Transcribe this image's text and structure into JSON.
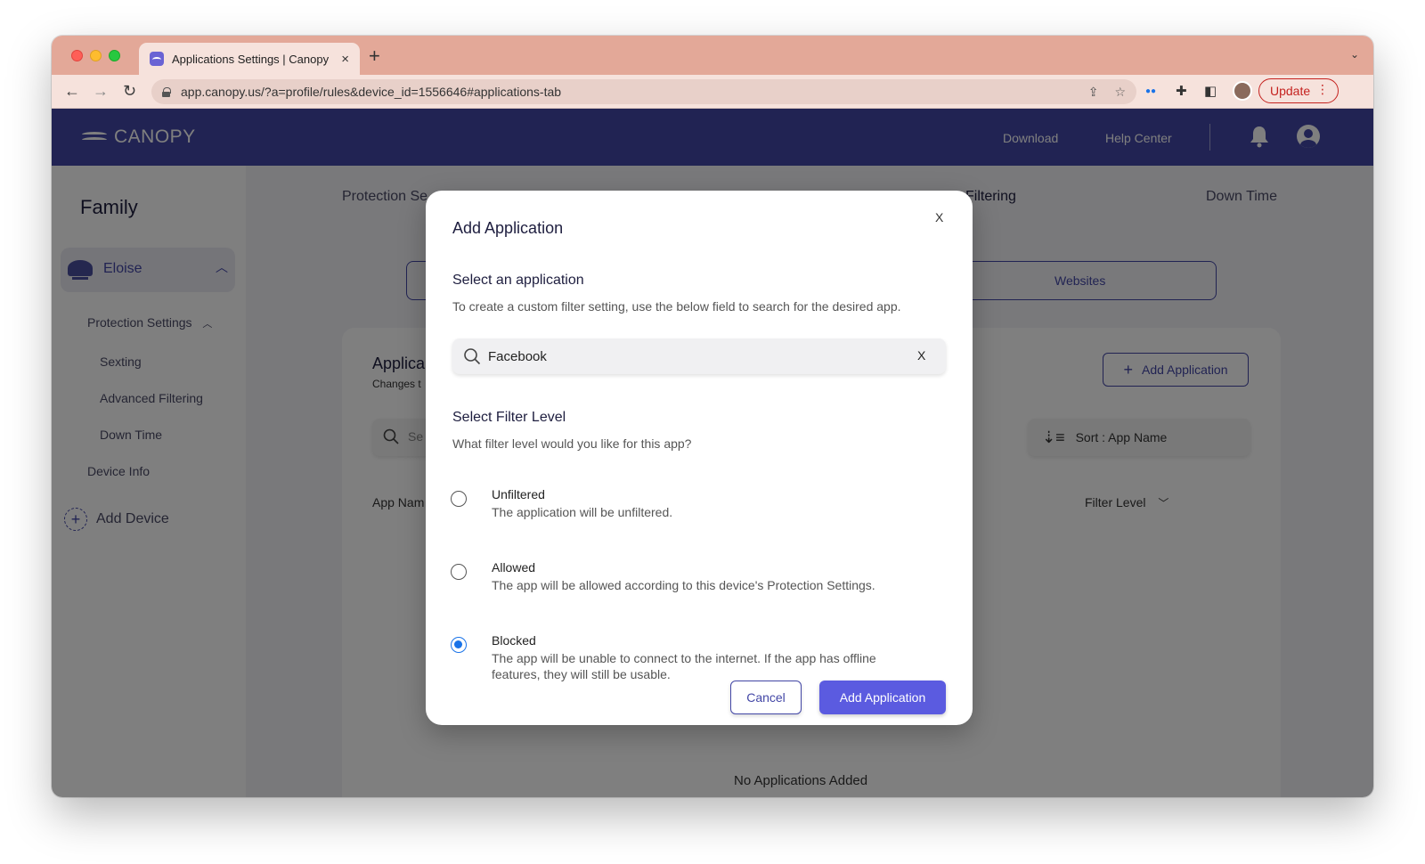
{
  "browser": {
    "tab_title": "Applications Settings | Canopy",
    "tab_close": "×",
    "new_tab": "+",
    "url": "app.canopy.us/?a=profile/rules&device_id=1556646#applications-tab",
    "update_label": "Update"
  },
  "appbar": {
    "brand": "CANOPY",
    "links": [
      "Download",
      "Help Center"
    ],
    "color": "#4347a6"
  },
  "sidebar": {
    "heading": "Family",
    "device_name": "Eloise",
    "items": [
      "Protection Settings",
      "Sexting",
      "Advanced Filtering",
      "Down Time",
      "Device Info"
    ],
    "add_device": "Add Device"
  },
  "content": {
    "tabs": [
      "Protection Se",
      "Filtering",
      "Down Time"
    ],
    "segment_websites": "Websites",
    "card_title": "Applica",
    "card_subtitle": "Changes t",
    "add_application": "Add Application",
    "search_placeholder": "Se",
    "sort_label": "Sort : App Name",
    "col_app_name": "App Nam",
    "col_filter_level": "Filter Level",
    "empty_message": "No Applications Added"
  },
  "modal": {
    "title": "Add Application",
    "close": "X",
    "select_heading": "Select an application",
    "select_desc": "To create a custom filter setting, use the below field to search for the desired app.",
    "search_value": "Facebook",
    "search_clear": "X",
    "filter_heading": "Select Filter Level",
    "filter_desc": "What filter level would you like for this app?",
    "options": [
      {
        "title": "Unfiltered",
        "desc": "The application will be unfiltered.",
        "checked": false
      },
      {
        "title": "Allowed",
        "desc": "The app will be allowed according to this device's Protection Settings.",
        "checked": false
      },
      {
        "title": "Blocked",
        "desc": "The app will be unable to connect to the internet. If the app has offline features, they will still be usable.",
        "checked": true
      }
    ],
    "cancel_label": "Cancel",
    "submit_label": "Add Application",
    "accent": "#5b5be0"
  }
}
